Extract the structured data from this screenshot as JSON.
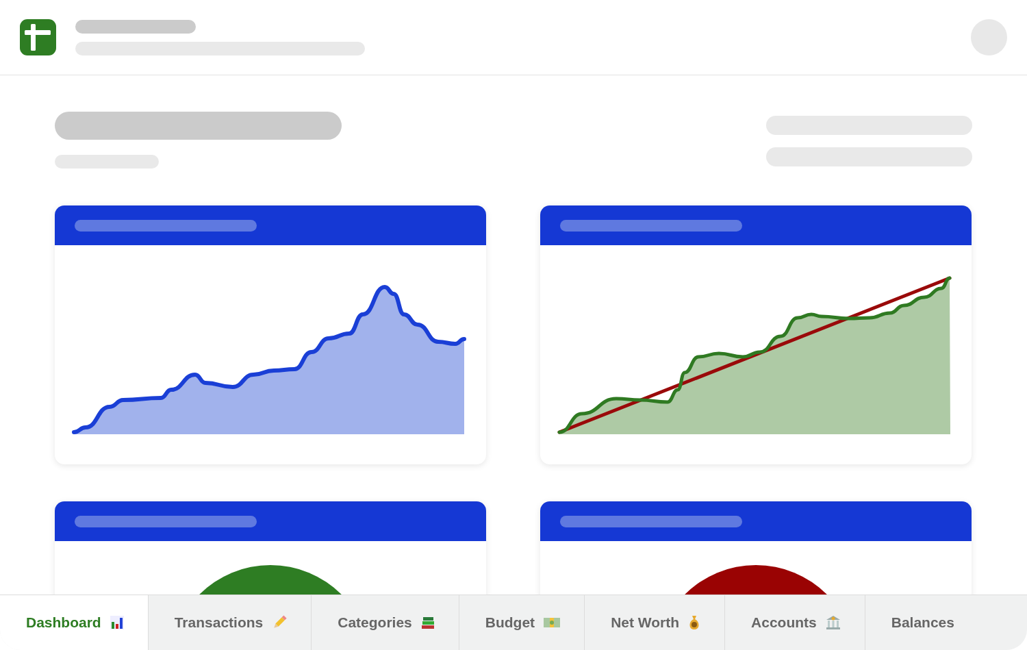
{
  "tabs": [
    {
      "label": "Dashboard",
      "selected": true
    },
    {
      "label": "Transactions",
      "selected": false
    },
    {
      "label": "Categories",
      "selected": false
    },
    {
      "label": "Budget",
      "selected": false
    },
    {
      "label": "Net Worth",
      "selected": false
    },
    {
      "label": "Accounts",
      "selected": false
    },
    {
      "label": "Balances",
      "selected": false
    }
  ]
}
